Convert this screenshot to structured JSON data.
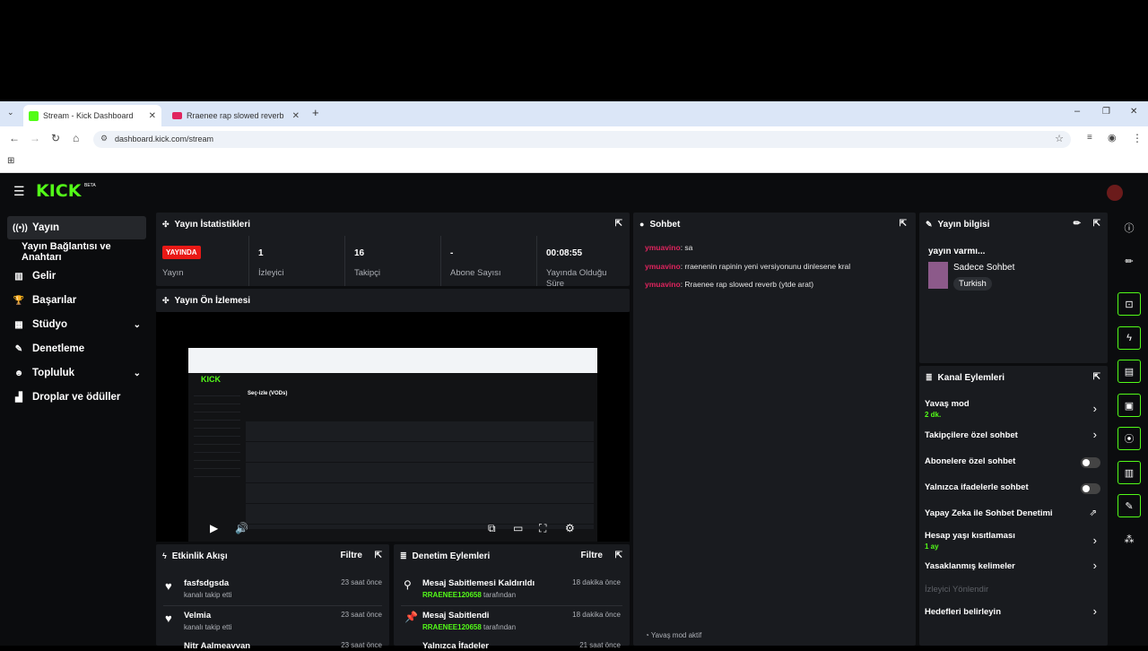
{
  "browser": {
    "tabs": [
      {
        "title": "Stream - Kick Dashboard",
        "favicon_color": "#53fc18"
      },
      {
        "title": "Rraenee rap slowed reverb - Yo",
        "favicon_color": "#ff0000"
      }
    ],
    "url": "dashboard.kick.com/stream"
  },
  "app": {
    "logo": "KICK",
    "logo_badge": "BETA",
    "accent": "#53fc18"
  },
  "sidebar": {
    "items": [
      {
        "label": "Yayın",
        "icon": "broadcast-icon"
      },
      {
        "label": "Yayın Bağlantısı ve Anahtarı",
        "icon": ""
      },
      {
        "label": "Gelir",
        "icon": "chart-icon"
      },
      {
        "label": "Başarılar",
        "icon": "trophy-icon"
      },
      {
        "label": "Stüdyo",
        "icon": "studio-icon"
      },
      {
        "label": "Denetleme",
        "icon": "wrench-icon"
      },
      {
        "label": "Topluluk",
        "icon": "people-icon"
      },
      {
        "label": "Droplar ve ödüller",
        "icon": "gift-icon"
      }
    ]
  },
  "stats": {
    "title": "Yayın İstatistikleri",
    "live_badge": "YAYINDA",
    "live_label": "Yayın",
    "viewers_value": "1",
    "viewers_label": "İzleyici",
    "followers_value": "16",
    "followers_label": "Takipçi",
    "subs_value": "-",
    "subs_label": "Abone Sayısı",
    "uptime_value": "00:08:55",
    "uptime_label": "Yayında Olduğu Süre"
  },
  "preview": {
    "title": "Yayın Ön İzlemesi",
    "inner_heading": "Seç-izle (VODs)",
    "inner_logo": "KICK"
  },
  "activity": {
    "title": "Etkinlik Akışı",
    "filter": "Filtre",
    "items": [
      {
        "name": "fasfsdgsda",
        "desc": "kanalı takip etti",
        "time": "23 saat önce"
      },
      {
        "name": "Velmia",
        "desc": "kanalı takip etti",
        "time": "23 saat önce"
      },
      {
        "name": "Nitr Aalmeavvan",
        "desc": "",
        "time": "23 saat önce"
      }
    ]
  },
  "moderation": {
    "title": "Denetim Eylemleri",
    "filter": "Filtre",
    "items": [
      {
        "action": "Mesaj Sabitlemesi Kaldırıldı",
        "user": "RRAENEE120658",
        "suffix": "tarafından",
        "time": "18 dakika önce"
      },
      {
        "action": "Mesaj Sabitlendi",
        "user": "RRAENEE120658",
        "suffix": "tarafından",
        "time": "18 dakika önce"
      },
      {
        "action": "Yalnızca İfadeler",
        "user": "",
        "suffix": "",
        "time": "21 saat önce"
      }
    ]
  },
  "chat": {
    "title": "Sohbet",
    "messages": [
      {
        "user": "ymuavino",
        "text": ": sa"
      },
      {
        "user": "ymuavino",
        "text": ": rraenenin rapinin yeni versiyonunu dinlesene kral"
      },
      {
        "user": "ymuavino",
        "text": ": Rraenee rap slowed reverb (ytde arat)"
      }
    ],
    "status": "Yavaş mod aktif"
  },
  "stream_info": {
    "title": "Yayın bilgisi",
    "stream_title": "yayın varmı...",
    "category": "Sadece Sohbet",
    "tag": "Turkish"
  },
  "channel_actions": {
    "title": "Kanal Eylemleri",
    "items": [
      {
        "label": "Yavaş mod",
        "sub": "2 dk.",
        "kind": "arrow"
      },
      {
        "label": "Takipçilere özel sohbet",
        "sub": "",
        "kind": "arrow"
      },
      {
        "label": "Abonelere özel sohbet",
        "sub": "",
        "kind": "toggle"
      },
      {
        "label": "Yalnızca ifadelerle sohbet",
        "sub": "",
        "kind": "toggle"
      },
      {
        "label": "Yapay Zeka ile Sohbet Denetimi",
        "sub": "",
        "kind": "external"
      },
      {
        "label": "Hesap yaşı kısıtlaması",
        "sub": "1 ay",
        "kind": "arrow"
      },
      {
        "label": "Yasaklanmış kelimeler",
        "sub": "",
        "kind": "arrow"
      },
      {
        "label": "İzleyici Yönlendir",
        "sub": "",
        "kind": "disabled"
      },
      {
        "label": "Hedefleri belirleyin",
        "sub": "",
        "kind": "arrow"
      }
    ]
  }
}
